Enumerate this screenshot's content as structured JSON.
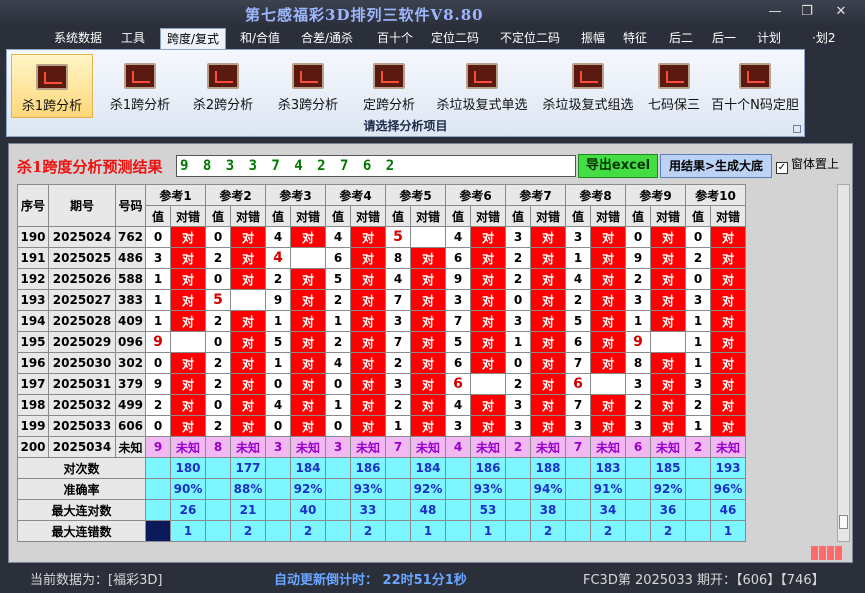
{
  "window": {
    "title": "第七感福彩3D排列三软件V8.80"
  },
  "menu": [
    {
      "label": "系统数据"
    },
    {
      "label": "工具"
    },
    {
      "label": "跨度/复式",
      "active": true
    },
    {
      "label": "和/合值"
    },
    {
      "label": "合差/通杀"
    },
    {
      "label": "百十个"
    },
    {
      "label": "定位二码"
    },
    {
      "label": "不定位二码"
    },
    {
      "label": "振幅"
    },
    {
      "label": "特征"
    },
    {
      "label": "后二"
    },
    {
      "label": "后一"
    },
    {
      "label": "计划"
    },
    {
      "label": "·划2"
    }
  ],
  "ribbon": {
    "buttons": [
      {
        "label": "杀1跨分析",
        "active": true
      },
      {
        "label": "杀1跨分析"
      },
      {
        "label": "杀2跨分析"
      },
      {
        "label": "杀3跨分析"
      },
      {
        "label": "定跨分析"
      },
      {
        "label": "杀垃圾复式单选"
      },
      {
        "label": "杀垃圾复式组选"
      },
      {
        "label": "七码保三"
      },
      {
        "label": "百十个N码定胆"
      }
    ],
    "caption": "请选择分析项目"
  },
  "panel": {
    "title": "杀1跨度分析预测结果",
    "result": "9 8 3 3 7 4 2 7 6 2",
    "export_button": "导出excel",
    "generate_button": "用结果>生成大底",
    "topmost_label": "窗体置上",
    "topmost_checked": true
  },
  "table": {
    "col_seq": "序号",
    "col_period": "期号",
    "col_number": "号码",
    "refs": [
      "参考1",
      "参考2",
      "参考3",
      "参考4",
      "参考5",
      "参考6",
      "参考7",
      "参考8",
      "参考9",
      "参考10"
    ],
    "sub_value": "值",
    "sub_result": "对错",
    "hit_text": "对",
    "unknown_text": "未知",
    "rows": [
      {
        "seq": "190",
        "period": "2025024",
        "num": "762",
        "cells": [
          [
            "0",
            1
          ],
          [
            "0",
            1
          ],
          [
            "4",
            1
          ],
          [
            "4",
            1
          ],
          [
            "5",
            0
          ],
          [
            "4",
            1
          ],
          [
            "3",
            1
          ],
          [
            "3",
            1
          ],
          [
            "0",
            1
          ],
          [
            "0",
            1
          ]
        ]
      },
      {
        "seq": "191",
        "period": "2025025",
        "num": "486",
        "cells": [
          [
            "3",
            1
          ],
          [
            "2",
            1
          ],
          [
            "4",
            0
          ],
          [
            "6",
            1
          ],
          [
            "8",
            1
          ],
          [
            "6",
            1
          ],
          [
            "2",
            1
          ],
          [
            "1",
            1
          ],
          [
            "9",
            1
          ],
          [
            "2",
            1
          ]
        ]
      },
      {
        "seq": "192",
        "period": "2025026",
        "num": "588",
        "cells": [
          [
            "1",
            1
          ],
          [
            "0",
            1
          ],
          [
            "2",
            1
          ],
          [
            "5",
            1
          ],
          [
            "4",
            1
          ],
          [
            "9",
            1
          ],
          [
            "2",
            1
          ],
          [
            "4",
            1
          ],
          [
            "2",
            1
          ],
          [
            "0",
            1
          ]
        ]
      },
      {
        "seq": "193",
        "period": "2025027",
        "num": "383",
        "cells": [
          [
            "1",
            1
          ],
          [
            "5",
            0
          ],
          [
            "9",
            1
          ],
          [
            "2",
            1
          ],
          [
            "7",
            1
          ],
          [
            "3",
            1
          ],
          [
            "0",
            1
          ],
          [
            "2",
            1
          ],
          [
            "3",
            1
          ],
          [
            "3",
            1
          ]
        ]
      },
      {
        "seq": "194",
        "period": "2025028",
        "num": "409",
        "cells": [
          [
            "1",
            1
          ],
          [
            "2",
            1
          ],
          [
            "1",
            1
          ],
          [
            "1",
            1
          ],
          [
            "3",
            1
          ],
          [
            "7",
            1
          ],
          [
            "3",
            1
          ],
          [
            "5",
            1
          ],
          [
            "1",
            1
          ],
          [
            "1",
            1
          ]
        ]
      },
      {
        "seq": "195",
        "period": "2025029",
        "num": "096",
        "cells": [
          [
            "9",
            0
          ],
          [
            "0",
            1
          ],
          [
            "5",
            1
          ],
          [
            "2",
            1
          ],
          [
            "7",
            1
          ],
          [
            "5",
            1
          ],
          [
            "1",
            1
          ],
          [
            "6",
            1
          ],
          [
            "9",
            0
          ],
          [
            "1",
            1
          ]
        ]
      },
      {
        "seq": "196",
        "period": "2025030",
        "num": "302",
        "cells": [
          [
            "0",
            1
          ],
          [
            "2",
            1
          ],
          [
            "1",
            1
          ],
          [
            "4",
            1
          ],
          [
            "2",
            1
          ],
          [
            "6",
            1
          ],
          [
            "0",
            1
          ],
          [
            "7",
            1
          ],
          [
            "8",
            1
          ],
          [
            "1",
            1
          ]
        ]
      },
      {
        "seq": "197",
        "period": "2025031",
        "num": "379",
        "cells": [
          [
            "9",
            1
          ],
          [
            "2",
            1
          ],
          [
            "0",
            1
          ],
          [
            "0",
            1
          ],
          [
            "3",
            1
          ],
          [
            "6",
            0
          ],
          [
            "2",
            1
          ],
          [
            "6",
            0
          ],
          [
            "3",
            1
          ],
          [
            "3",
            1
          ]
        ]
      },
      {
        "seq": "198",
        "period": "2025032",
        "num": "499",
        "cells": [
          [
            "2",
            1
          ],
          [
            "0",
            1
          ],
          [
            "4",
            1
          ],
          [
            "1",
            1
          ],
          [
            "2",
            1
          ],
          [
            "4",
            1
          ],
          [
            "3",
            1
          ],
          [
            "7",
            1
          ],
          [
            "2",
            1
          ],
          [
            "2",
            1
          ]
        ]
      },
      {
        "seq": "199",
        "period": "2025033",
        "num": "606",
        "cells": [
          [
            "0",
            1
          ],
          [
            "2",
            1
          ],
          [
            "0",
            1
          ],
          [
            "0",
            1
          ],
          [
            "1",
            1
          ],
          [
            "3",
            1
          ],
          [
            "3",
            1
          ],
          [
            "3",
            1
          ],
          [
            "3",
            1
          ],
          [
            "1",
            1
          ]
        ]
      }
    ],
    "last_row": {
      "seq": "200",
      "period": "2025034",
      "num": "未知",
      "values": [
        "9",
        "8",
        "3",
        "3",
        "7",
        "4",
        "2",
        "7",
        "6",
        "2"
      ]
    },
    "stats": [
      {
        "label": "对次数",
        "values": [
          "180",
          "177",
          "184",
          "186",
          "184",
          "186",
          "188",
          "183",
          "185",
          "193"
        ]
      },
      {
        "label": "准确率",
        "values": [
          "90%",
          "88%",
          "92%",
          "93%",
          "92%",
          "93%",
          "94%",
          "91%",
          "92%",
          "96%"
        ]
      },
      {
        "label": "最大连对数",
        "values": [
          "26",
          "21",
          "40",
          "33",
          "48",
          "53",
          "38",
          "34",
          "36",
          "46"
        ]
      },
      {
        "label": "最大连错数",
        "values": [
          "1",
          "2",
          "2",
          "2",
          "1",
          "1",
          "2",
          "2",
          "2",
          "1"
        ]
      }
    ]
  },
  "status": {
    "current_data": "当前数据为：[福彩3D]",
    "countdown": "自动更新倒计时：  22时51分1秒",
    "draw_info": "FC3D第 2025033 期开：【606】【746】"
  }
}
